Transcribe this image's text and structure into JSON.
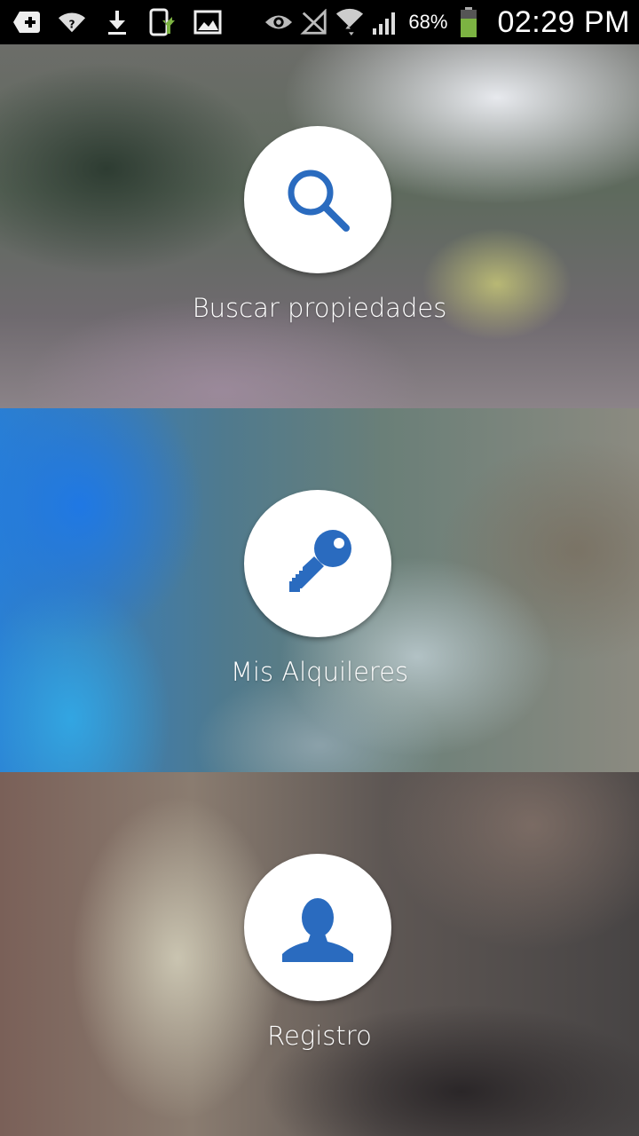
{
  "status_bar": {
    "battery_percent": "68%",
    "time": "02:29 PM",
    "left_icons": [
      "plus-badge-icon",
      "wifi-question-icon",
      "download-icon",
      "phone-update-icon",
      "image-icon"
    ],
    "right_icons": [
      "eye-icon",
      "no-signal-icon",
      "wifi-data-icon",
      "cell-signal-icon",
      "battery-icon"
    ],
    "battery_level": 0.68,
    "battery_color": "#7cb342"
  },
  "menu": {
    "accent_color": "#2a6bbf",
    "items": [
      {
        "label": "Buscar propiedades",
        "icon": "search-icon"
      },
      {
        "label": "Mis Alquileres",
        "icon": "key-icon"
      },
      {
        "label": "Registro",
        "icon": "user-icon"
      }
    ]
  }
}
